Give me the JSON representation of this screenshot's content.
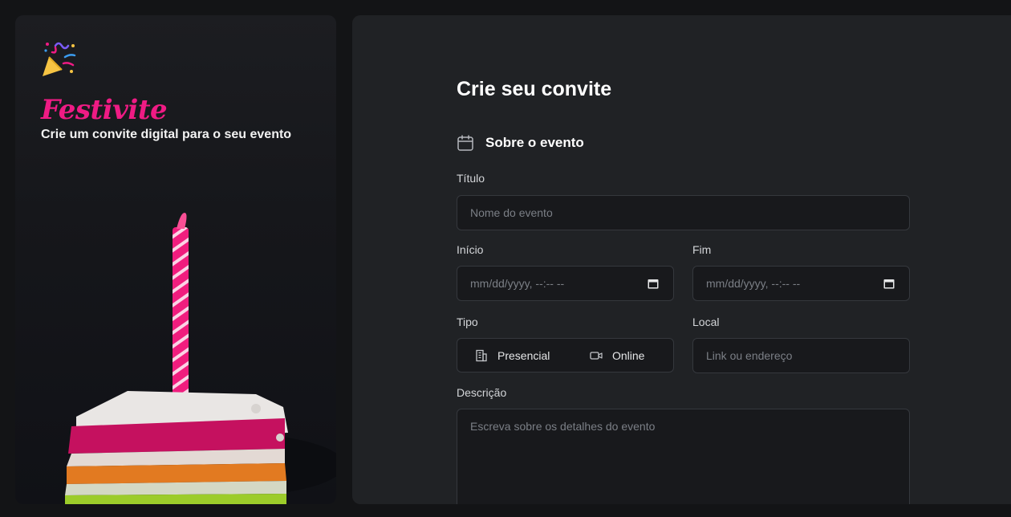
{
  "brand": {
    "name": "Festivite",
    "tagline": "Crie um convite digital para o seu evento"
  },
  "form": {
    "title": "Crie seu convite",
    "section_title": "Sobre o evento",
    "title_field": {
      "label": "Título",
      "placeholder": "Nome do evento"
    },
    "start_field": {
      "label": "Início",
      "placeholder": "mm/dd/yyyy, --:-- --"
    },
    "end_field": {
      "label": "Fim",
      "placeholder": "mm/dd/yyyy, --:-- --"
    },
    "type_field": {
      "label": "Tipo",
      "options": [
        "Presencial",
        "Online"
      ]
    },
    "location_field": {
      "label": "Local",
      "placeholder": "Link ou endereço"
    },
    "description_field": {
      "label": "Descrição",
      "placeholder": "Escreva sobre os detalhes do evento"
    }
  },
  "icons": {
    "logo": "party-popper-icon",
    "section": "calendar-icon",
    "date_picker": "calendar-icon",
    "in_person": "building-icon",
    "online": "video-camera-icon"
  },
  "colors": {
    "brand_pink": "#ef1b84",
    "background": "#131416",
    "panel": "#202225",
    "input_bg": "#18191c",
    "input_border": "#35383d"
  }
}
